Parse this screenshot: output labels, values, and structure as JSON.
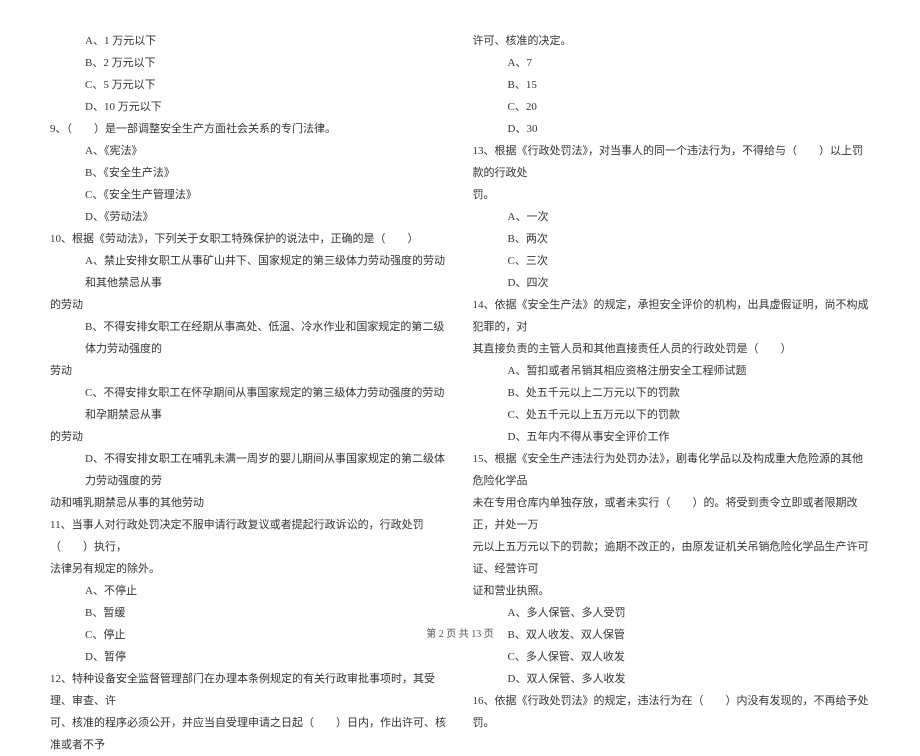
{
  "left_column": {
    "opt_a": "A、1 万元以下",
    "opt_b": "B、2 万元以下",
    "opt_c": "C、5 万元以下",
    "opt_d": "D、10 万元以下",
    "q9": "9、（　　）是一部调整安全生产方面社会关系的专门法律。",
    "q9_a": "A、《宪法》",
    "q9_b": "B、《安全生产法》",
    "q9_c": "C、《安全生产管理法》",
    "q9_d": "D、《劳动法》",
    "q10": "10、根据《劳动法》，下列关于女职工特殊保护的说法中，正确的是（　　）",
    "q10_a": "A、禁止安排女职工从事矿山井下、国家规定的第三级体力劳动强度的劳动和其他禁忌从事",
    "q10_a2": "的劳动",
    "q10_b": "B、不得安排女职工在经期从事高处、低温、冷水作业和国家规定的第二级体力劳动强度的",
    "q10_b2": "劳动",
    "q10_c": "C、不得安排女职工在怀孕期间从事国家规定的第三级体力劳动强度的劳动和孕期禁忌从事",
    "q10_c2": "的劳动",
    "q10_d": "D、不得安排女职工在哺乳未满一周岁的婴儿期间从事国家规定的第二级体力劳动强度的劳",
    "q10_d2": "动和哺乳期禁忌从事的其他劳动",
    "q11": "11、当事人对行政处罚决定不服申请行政复议或者提起行政诉讼的，行政处罚（　　）执行，",
    "q11_2": "法律另有规定的除外。",
    "q11_a": "A、不停止",
    "q11_b": "B、暂缓",
    "q11_c": "C、停止",
    "q11_d": "D、暂停",
    "q12": "12、特种设备安全监督管理部门在办理本条例规定的有关行政审批事项时，其受理、审查、许",
    "q12_2": "可、核准的程序必须公开，并应当自受理申请之日起（　　）日内，作出许可、核准或者不予"
  },
  "right_column": {
    "q12_cont": "许可、核准的决定。",
    "q12_a": "A、7",
    "q12_b": "B、15",
    "q12_c": "C、20",
    "q12_d": "D、30",
    "q13": "13、根据《行政处罚法》，对当事人的同一个违法行为，不得给与（　　）以上罚款的行政处",
    "q13_2": "罚。",
    "q13_a": "A、一次",
    "q13_b": "B、两次",
    "q13_c": "C、三次",
    "q13_d": "D、四次",
    "q14": "14、依据《安全生产法》的规定，承担安全评价的机构，出具虚假证明，尚不构成犯罪的，对",
    "q14_2": "其直接负责的主管人员和其他直接责任人员的行政处罚是（　　）",
    "q14_a": "A、暂扣或者吊销其相应资格注册安全工程师试题",
    "q14_b": "B、处五千元以上二万元以下的罚款",
    "q14_c": "C、处五千元以上五万元以下的罚款",
    "q14_d": "D、五年内不得从事安全评价工作",
    "q15": "15、根据《安全生产违法行为处罚办法》，剧毒化学品以及构成重大危险源的其他危险化学品",
    "q15_2": "未在专用仓库内单独存放，或者未实行（　　）的。将受到责令立即或者限期改正，并处一万",
    "q15_3": "元以上五万元以下的罚款；逾期不改正的，由原发证机关吊销危险化学品生产许可证、经营许可",
    "q15_4": "证和营业执照。",
    "q15_a": "A、多人保管、多人受罚",
    "q15_b": "B、双人收发、双人保管",
    "q15_c": "C、多人保管、双人收发",
    "q15_d": "D、双人保管、多人收发",
    "q16": "16、依据《行政处罚法》的规定，违法行为在（　　）内没有发现的，不再给予处罚。"
  },
  "footer": "第 2 页 共 13 页"
}
